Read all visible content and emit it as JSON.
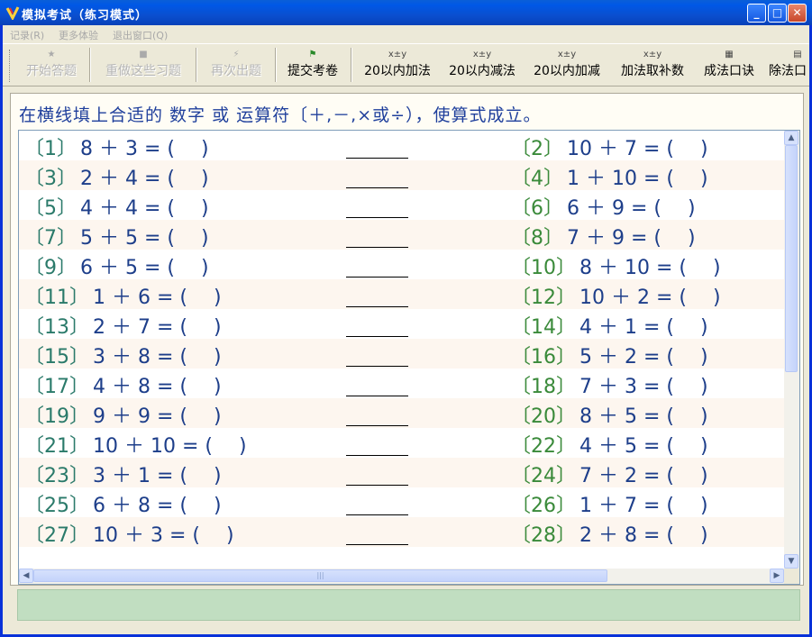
{
  "window": {
    "title": "模拟考试（练习模式）"
  },
  "menu": [
    "记录(R)",
    "更多体验",
    "退出窗口(Q)"
  ],
  "toolbar": [
    {
      "label": "开始答题",
      "icon": "start-icon",
      "disabled": true
    },
    {
      "label": "重做这些习题",
      "icon": "redo-icon",
      "disabled": true
    },
    {
      "label": "再次出题",
      "icon": "regenerate-icon",
      "disabled": true
    },
    {
      "label": "提交考卷",
      "icon": "submit-flag-icon",
      "disabled": false
    },
    {
      "label": "20以内加法",
      "icon": "formula-icon",
      "disabled": false
    },
    {
      "label": "20以内减法",
      "icon": "formula-icon",
      "disabled": false
    },
    {
      "label": "20以内加减",
      "icon": "formula-icon",
      "disabled": false
    },
    {
      "label": "加法取补数",
      "icon": "formula-icon",
      "disabled": false
    },
    {
      "label": "成法口诀",
      "icon": "calculator-icon",
      "disabled": false
    },
    {
      "label": "除法口",
      "icon": "document-icon",
      "disabled": false
    }
  ],
  "instruction": "在横线填上合适的 数字 或 运算符〔＋,－,×或÷），使算式成立。",
  "questions": [
    {
      "left": {
        "num": "〔1〕",
        "expr": "8 ＋ 3 = (　 )"
      },
      "right": {
        "num": "〔2〕",
        "expr": "10 ＋ 7 = (　 )"
      }
    },
    {
      "left": {
        "num": "〔3〕",
        "expr": "2 ＋ 4 = (　 )"
      },
      "right": {
        "num": "〔4〕",
        "expr": "1 ＋ 10 = (　 )"
      }
    },
    {
      "left": {
        "num": "〔5〕",
        "expr": "4 ＋ 4 = (　 )"
      },
      "right": {
        "num": "〔6〕",
        "expr": "6 ＋ 9 = (　 )"
      }
    },
    {
      "left": {
        "num": "〔7〕",
        "expr": "5 ＋ 5 = (　 )"
      },
      "right": {
        "num": "〔8〕",
        "expr": "7 ＋ 9 = (　 )"
      }
    },
    {
      "left": {
        "num": "〔9〕",
        "expr": "6 ＋ 5 = (　 )"
      },
      "right": {
        "num": "〔10〕",
        "expr": "8 ＋ 10 = (　 )"
      }
    },
    {
      "left": {
        "num": "〔11〕",
        "expr": "1 ＋ 6 = (　 )"
      },
      "right": {
        "num": "〔12〕",
        "expr": "10 ＋ 2 = (　 )"
      }
    },
    {
      "left": {
        "num": "〔13〕",
        "expr": "2 ＋ 7 = (　 )"
      },
      "right": {
        "num": "〔14〕",
        "expr": "4 ＋ 1 = (　 )"
      }
    },
    {
      "left": {
        "num": "〔15〕",
        "expr": "3 ＋ 8 = (　 )"
      },
      "right": {
        "num": "〔16〕",
        "expr": "5 ＋ 2 = (　 )"
      }
    },
    {
      "left": {
        "num": "〔17〕",
        "expr": "4 ＋ 8 = (　 )"
      },
      "right": {
        "num": "〔18〕",
        "expr": "7 ＋ 3 = (　 )"
      }
    },
    {
      "left": {
        "num": "〔19〕",
        "expr": "9 ＋ 9 = (　 )"
      },
      "right": {
        "num": "〔20〕",
        "expr": "8 ＋ 5 = (　 )"
      }
    },
    {
      "left": {
        "num": "〔21〕",
        "expr": "10 ＋ 10 = (　 )"
      },
      "right": {
        "num": "〔22〕",
        "expr": "4 ＋ 5 = (　 )"
      }
    },
    {
      "left": {
        "num": "〔23〕",
        "expr": "3 ＋ 1 = (　 )"
      },
      "right": {
        "num": "〔24〕",
        "expr": "7 ＋ 2 = (　 )"
      }
    },
    {
      "left": {
        "num": "〔25〕",
        "expr": "6 ＋ 8 = (　 )"
      },
      "right": {
        "num": "〔26〕",
        "expr": "1 ＋ 7 = (　 )"
      }
    },
    {
      "left": {
        "num": "〔27〕",
        "expr": "10 ＋ 3 = (　 )"
      },
      "right": {
        "num": "〔28〕",
        "expr": "2 ＋ 8 = (　 )"
      }
    }
  ],
  "colors": {
    "title_bar": "#0058e6",
    "text_blue": "#1d3e8a",
    "status_bar": "#c1dec1"
  }
}
